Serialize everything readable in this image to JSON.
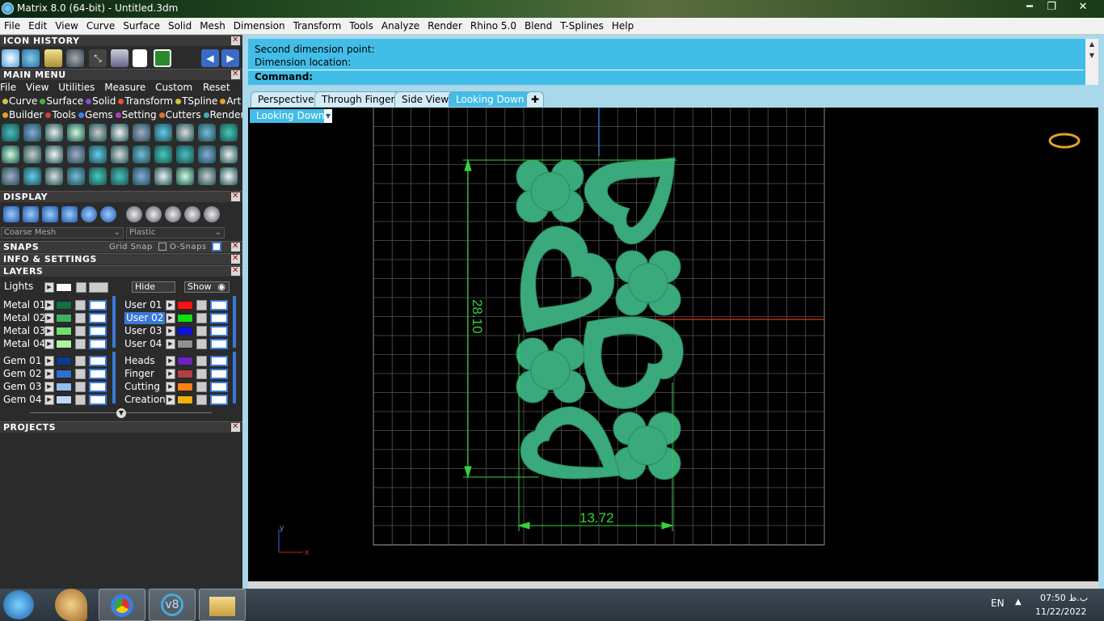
{
  "window": {
    "title": "Matrix 8.0 (64-bit) - Untitled.3dm",
    "minimize": "━",
    "restore": "❐",
    "close": "✕"
  },
  "menubar": [
    "File",
    "Edit",
    "View",
    "Curve",
    "Surface",
    "Solid",
    "Mesh",
    "Dimension",
    "Transform",
    "Tools",
    "Analyze",
    "Render",
    "Rhino 5.0",
    "Blend",
    "T-Splines",
    "Help"
  ],
  "panel": {
    "icon_history": "ICON HISTORY",
    "main_menu": "MAIN MENU",
    "main_menu_items": [
      "File",
      "View",
      "Utilities",
      "Measure",
      "Custom"
    ],
    "reset": "Reset",
    "category_row1": [
      {
        "label": "Curve",
        "color": "#d4c040"
      },
      {
        "label": "Surface",
        "color": "#48b048"
      },
      {
        "label": "Solid",
        "color": "#8050d0"
      },
      {
        "label": "Transform",
        "color": "#e05a2a"
      },
      {
        "label": "TSpline",
        "color": "#d4c040"
      },
      {
        "label": "Art",
        "color": "#e0a030"
      }
    ],
    "category_row2": [
      {
        "label": "Builder",
        "color": "#e0a030"
      },
      {
        "label": "Tools",
        "color": "#d04040"
      },
      {
        "label": "Gems",
        "color": "#4080e0"
      },
      {
        "label": "Setting",
        "color": "#b040c0"
      },
      {
        "label": "Cutters",
        "color": "#e07030"
      },
      {
        "label": "Render",
        "color": "#40b0b0"
      }
    ],
    "display": "DISPLAY",
    "display_mesh": "Coarse Mesh",
    "display_material": "Plastic",
    "snaps": "SNAPS",
    "grid_snap": "Grid Snap",
    "osnaps": "O-Snaps",
    "info_settings": "INFO & SETTINGS",
    "layers": "LAYERS",
    "lights": "Lights",
    "hide": "Hide",
    "show": "Show",
    "layers_left": [
      {
        "name": "Metal 01",
        "color": "#107040"
      },
      {
        "name": "Metal 02",
        "color": "#40b060"
      },
      {
        "name": "Metal 03",
        "color": "#70e070"
      },
      {
        "name": "Metal 04",
        "color": "#b0f0a0"
      },
      {
        "name": "Gem 01",
        "color": "#103890"
      },
      {
        "name": "Gem 02",
        "color": "#3070d0"
      },
      {
        "name": "Gem 03",
        "color": "#90c0f0"
      },
      {
        "name": "Gem 04",
        "color": "#c0d8f8"
      }
    ],
    "layers_right": [
      {
        "name": "User 01",
        "color": "#ff1010"
      },
      {
        "name": "User 02",
        "color": "#10e010"
      },
      {
        "name": "User 03",
        "color": "#1010e0"
      },
      {
        "name": "User 04",
        "color": "#909090"
      },
      {
        "name": "Heads",
        "color": "#7020c0"
      },
      {
        "name": "Finger",
        "color": "#b04040"
      },
      {
        "name": "Cutting",
        "color": "#ff8010"
      },
      {
        "name": "Creation",
        "color": "#f0b010"
      }
    ],
    "projects": "PROJECTS"
  },
  "command": {
    "line1": "Second dimension point:",
    "line2": "Dimension location:",
    "prompt": "Command:"
  },
  "tabs": [
    "Perspective",
    "Through Finger",
    "Side View",
    "Looking Down"
  ],
  "active_tab": "Looking Down",
  "viewport": {
    "label": "Looking Down",
    "dim_height": "28.10",
    "dim_width": "13.72",
    "axis_y": "y",
    "axis_x": "x"
  },
  "taskbar": {
    "lang": "EN",
    "time": "07:50 ب.ظ",
    "date": "11/22/2022"
  },
  "colors": {
    "accent": "#42bde8",
    "shape_fill": "#3aa97c",
    "dimension": "#37d23a",
    "grid": "#555555"
  }
}
